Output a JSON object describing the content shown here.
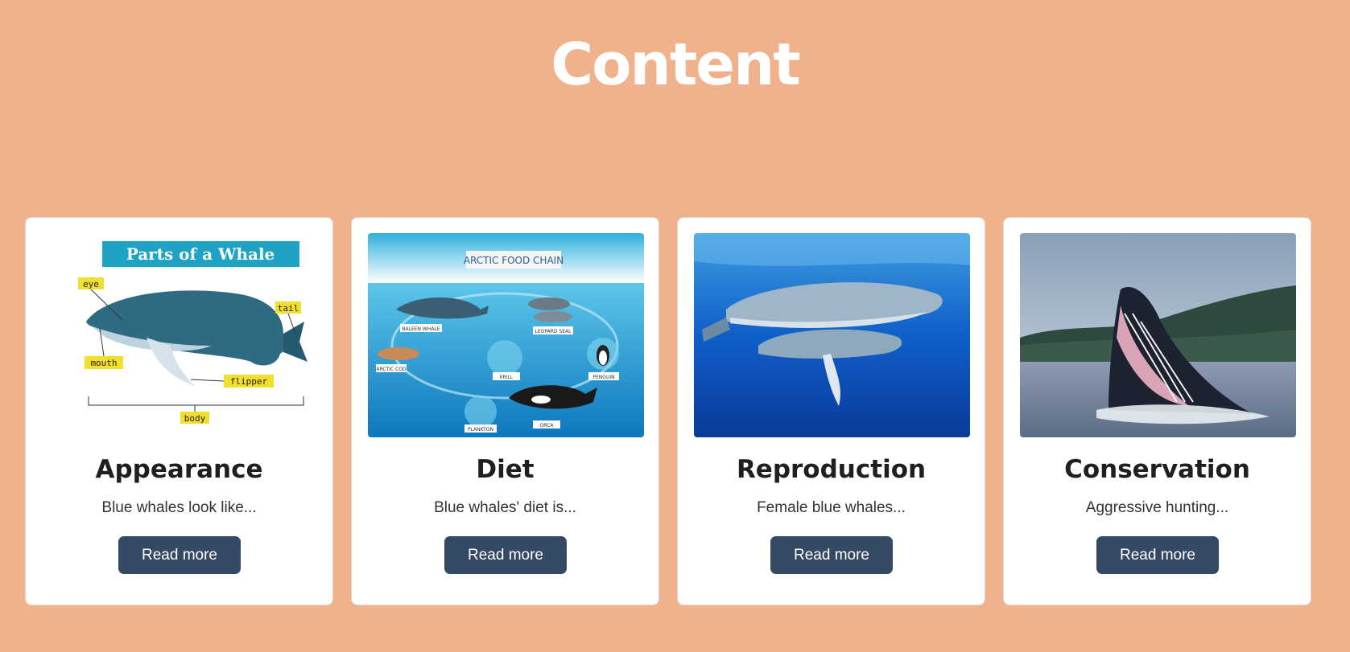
{
  "page": {
    "title": "Content",
    "background_color": "#f0b28c",
    "button_color": "#344963"
  },
  "cards": [
    {
      "title": "Appearance",
      "description": "Blue whales look like...",
      "button_label": "Read more",
      "image": {
        "heading": "Parts of a Whale",
        "labels": [
          "eye",
          "tail",
          "mouth",
          "flipper",
          "body"
        ]
      }
    },
    {
      "title": "Diet",
      "description": "Blue whales' diet is...",
      "button_label": "Read more",
      "image": {
        "heading": "ARCTIC FOOD CHAIN",
        "labels": [
          "BALEEN WHALE",
          "LEOPARD SEAL",
          "ARCTIC COD",
          "KRILL",
          "PENGUIN",
          "PLANKTON",
          "ORCA"
        ]
      }
    },
    {
      "title": "Reproduction",
      "description": "Female blue whales...",
      "button_label": "Read more",
      "image": {
        "subject": "whales-underwater-photo"
      }
    },
    {
      "title": "Conservation",
      "description": "Aggressive hunting...",
      "button_label": "Read more",
      "image": {
        "subject": "whale-breaching-photo"
      }
    }
  ]
}
